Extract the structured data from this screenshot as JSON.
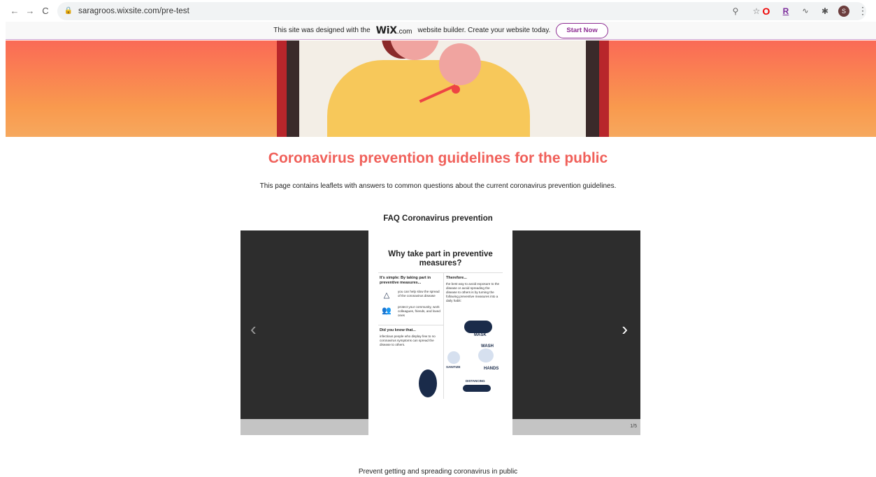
{
  "browser": {
    "back_icon": "←",
    "forward_icon": "→",
    "reload_icon": "C",
    "url": "saragroos.wixsite.com/pre-test"
  },
  "wix_banner": {
    "text_before": "This site was designed with the",
    "logo": "WiX",
    "dotcom": ".com",
    "text_after": "website builder. Create your website today.",
    "cta": "Start Now"
  },
  "page": {
    "title": "Coronavirus prevention guidelines for the public",
    "intro": "This page contains leaflets with answers to common questions about the current coronavirus prevention guidelines.",
    "faq_heading": "FAQ Coronavirus prevention",
    "bottom_heading": "Prevent getting and spreading coronavirus in public"
  },
  "slider": {
    "counter": "1/5",
    "prev_label": "‹",
    "next_label": "›",
    "leaflet": {
      "title": "Why take part in preventive measures?",
      "col_left_heading": "It's simple: By taking part in preventive measures...",
      "item1": "you can help slow the spread of the coronavirus disease",
      "item2": "protect your community, work colleagues, friends, and loved ones",
      "did_you_know_heading": "Did you know that...",
      "did_you_know_text": "infectious people who display few to no coronavirus symptoms can spread the disease to others.",
      "col_right_heading": "Therefore...",
      "col_right_text": "the best way to avoid exposure to the disease or avoid spreading the disease to others is by turning the following preventive measures into a daily habit:",
      "mask_label": "MASK",
      "wash_label": "WASH",
      "hands_label": "HANDS",
      "sanitize_label": "SANITIZE",
      "distancing_label": "DISTANCING"
    }
  },
  "colors": {
    "title": "#f0605a",
    "wix_purple": "#8e2d93",
    "hero_top": "#fa6a56",
    "hero_bottom": "#f6a85e",
    "slider_dark": "#2d2d2d"
  }
}
